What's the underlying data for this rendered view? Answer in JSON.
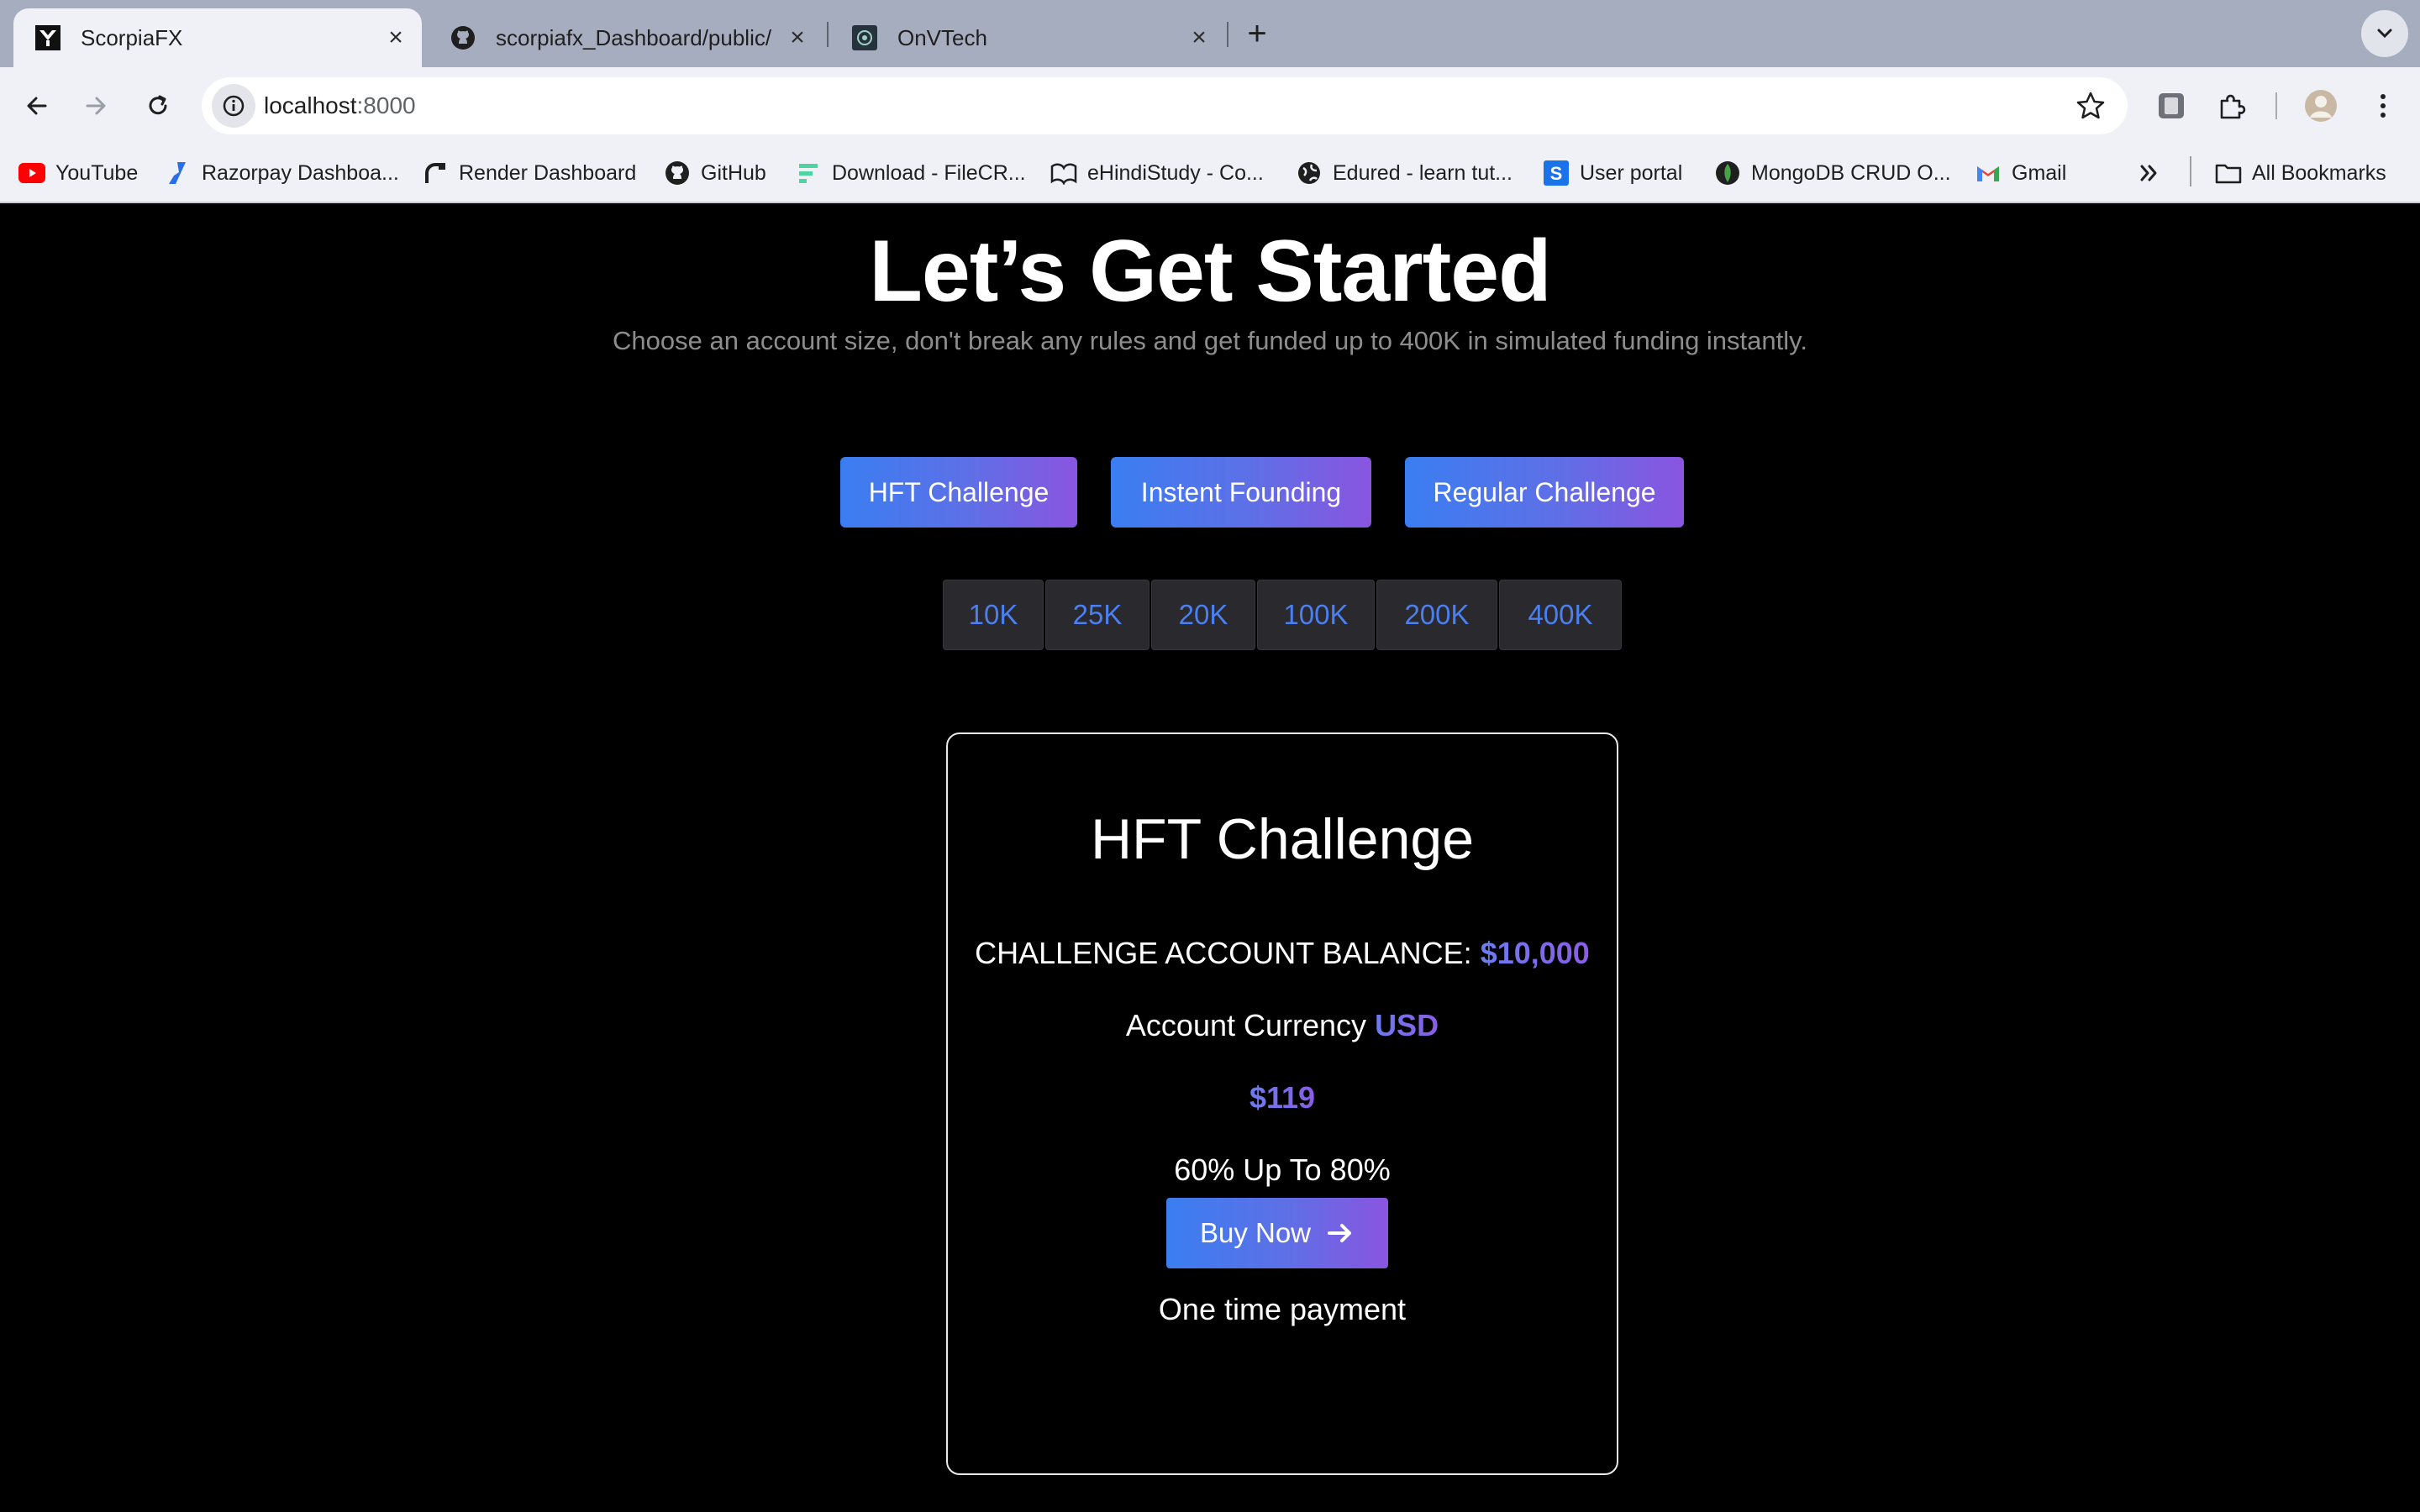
{
  "browser": {
    "tabs": [
      {
        "title": "ScorpiaFX",
        "icon": "scorpiafx-logo-icon",
        "active": true
      },
      {
        "title": "scorpiafx_Dashboard/public/",
        "icon": "github-icon",
        "active": false
      },
      {
        "title": "OnVTech",
        "icon": "onvtech-logo-icon",
        "active": false
      }
    ],
    "url_host": "localhost",
    "url_port": ":8000",
    "bookmarks": [
      {
        "label": "YouTube",
        "icon": "youtube-icon"
      },
      {
        "label": "Razorpay Dashboa...",
        "icon": "razorpay-icon"
      },
      {
        "label": "Render Dashboard",
        "icon": "render-icon"
      },
      {
        "label": "GitHub",
        "icon": "github-icon"
      },
      {
        "label": "Download - FileCR...",
        "icon": "filecr-icon"
      },
      {
        "label": "eHindiStudy - Co...",
        "icon": "ehindistudy-icon"
      },
      {
        "label": "Edured - learn tut...",
        "icon": "globe-icon"
      },
      {
        "label": "User portal",
        "icon": "user-portal-icon"
      },
      {
        "label": "MongoDB CRUD O...",
        "icon": "mongodb-icon"
      },
      {
        "label": "Gmail",
        "icon": "gmail-icon"
      }
    ],
    "all_bookmarks": "All Bookmarks"
  },
  "hero": {
    "title": "Let’s Get Started",
    "subtitle": "Choose an account size, don't break any rules and get funded up to 400K in simulated funding instantly."
  },
  "programs": [
    "HFT Challenge",
    "Instent Founding",
    "Regular Challenge"
  ],
  "sizes": [
    "10K",
    "25K",
    "20K",
    "100K",
    "200K",
    "400K"
  ],
  "card": {
    "title": "HFT Challenge",
    "balance_label": "CHALLENGE ACCOUNT BALANCE:",
    "balance_value": "$10,000",
    "currency_label": "Account Currency",
    "currency_value": "USD",
    "price": "$119",
    "profit_split": "60% Up To 80%",
    "buy_label": "Buy Now",
    "payment_note": "One time payment"
  },
  "colors": {
    "page_bg": "#000000",
    "button_gradient_start": "#3a7ef2",
    "button_gradient_end": "#8a55e0",
    "size_text": "#4c7ff0",
    "accent": "#7a6cec"
  }
}
